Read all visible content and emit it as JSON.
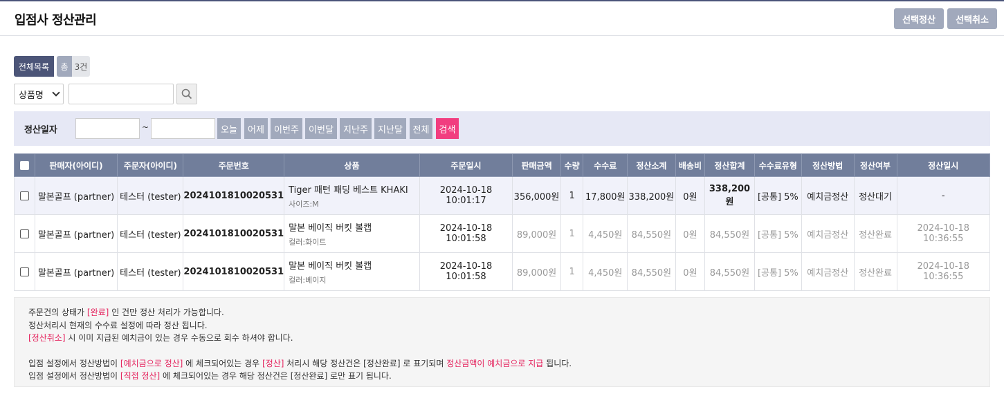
{
  "header": {
    "title": "입점사 정산관리",
    "btn_select_settle": "선택정산",
    "btn_select_cancel": "선택취소"
  },
  "tabs": {
    "all": "전체목록",
    "total_label": "총",
    "total_count": "3건"
  },
  "search": {
    "select_value": "상품명",
    "input_value": ""
  },
  "filter": {
    "label": "정산일자",
    "from": "",
    "tilde": "~",
    "to": "",
    "buttons": [
      "오늘",
      "어제",
      "이번주",
      "이번달",
      "지난주",
      "지난달",
      "전체"
    ],
    "search": "검색"
  },
  "table": {
    "headers": [
      "판매자(아이디)",
      "주문자(아이디)",
      "주문번호",
      "상품",
      "주문일시",
      "판매금액",
      "수량",
      "수수료",
      "정산소계",
      "배송비",
      "정산합계",
      "수수료유형",
      "정산방법",
      "정산여부",
      "정산일시"
    ],
    "rows": [
      {
        "seller": "말본골프 (partner)",
        "buyer": "테스터 (tester)",
        "order_no": "2024101810020531",
        "product": "Tiger 패턴 패딩 베스트 KHAKI",
        "option": "사이즈:M",
        "order_date": "2024-10-18 10:01:17",
        "price": "356,000원",
        "qty": "1",
        "fee": "17,800원",
        "subtotal": "338,200원",
        "shipping": "0원",
        "total": "338,200원",
        "fee_type": "[공통] 5%",
        "method": "예치금정산",
        "status": "정산대기",
        "settle_date": "-"
      },
      {
        "seller": "말본골프 (partner)",
        "buyer": "테스터 (tester)",
        "order_no": "2024101810020531",
        "product": "말본 베이직 버킷 볼캡",
        "option": "컬러:화이트",
        "order_date": "2024-10-18 10:01:58",
        "price": "89,000원",
        "qty": "1",
        "fee": "4,450원",
        "subtotal": "84,550원",
        "shipping": "0원",
        "total": "84,550원",
        "fee_type": "[공통] 5%",
        "method": "예치금정산",
        "status": "정산완료",
        "settle_date": "2024-10-18 10:36:55"
      },
      {
        "seller": "말본골프 (partner)",
        "buyer": "테스터 (tester)",
        "order_no": "2024101810020531",
        "product": "말본 베이직 버킷 볼캡",
        "option": "컬러:베이지",
        "order_date": "2024-10-18 10:01:58",
        "price": "89,000원",
        "qty": "1",
        "fee": "4,450원",
        "subtotal": "84,550원",
        "shipping": "0원",
        "total": "84,550원",
        "fee_type": "[공통] 5%",
        "method": "예치금정산",
        "status": "정산완료",
        "settle_date": "2024-10-18 10:36:55"
      }
    ]
  },
  "notice": {
    "l1a": "주문건의 상태가 ",
    "l1b": "[완료]",
    "l1c": " 인 건만 정산 처리가 가능합니다.",
    "l2": "정산처리시 현재의 수수료 설정에 따라 정산 됩니다.",
    "l3a": "[정산취소]",
    "l3b": " 시 이미 지급된 예치금이 있는 경우 수동으로 회수 하셔야 합니다.",
    "l4a": "입점 설정에서 정산방법이 ",
    "l4b": "[예치금으로 정산]",
    "l4c": " 에 체크되어있는 경우 ",
    "l4d": "[정산]",
    "l4e": " 처리시 해당 정산건은 [정산완료] 로 표기되며 ",
    "l4f": "정산금액이 예치금으로 지급",
    "l4g": " 됩니다.",
    "l5a": "입점 설정에서 정산방법이 ",
    "l5b": "[직접 정산]",
    "l5c": " 에 체크되어있는 경우 해당 정산건은 [정산완료] 로만 표기 됩니다."
  },
  "colors": {
    "primary": "#4c5578",
    "button_gray": "#a1a9bc",
    "search_pink": "#f13d7f",
    "table_header": "#717e9b",
    "highlight_red": "#e5245e"
  }
}
